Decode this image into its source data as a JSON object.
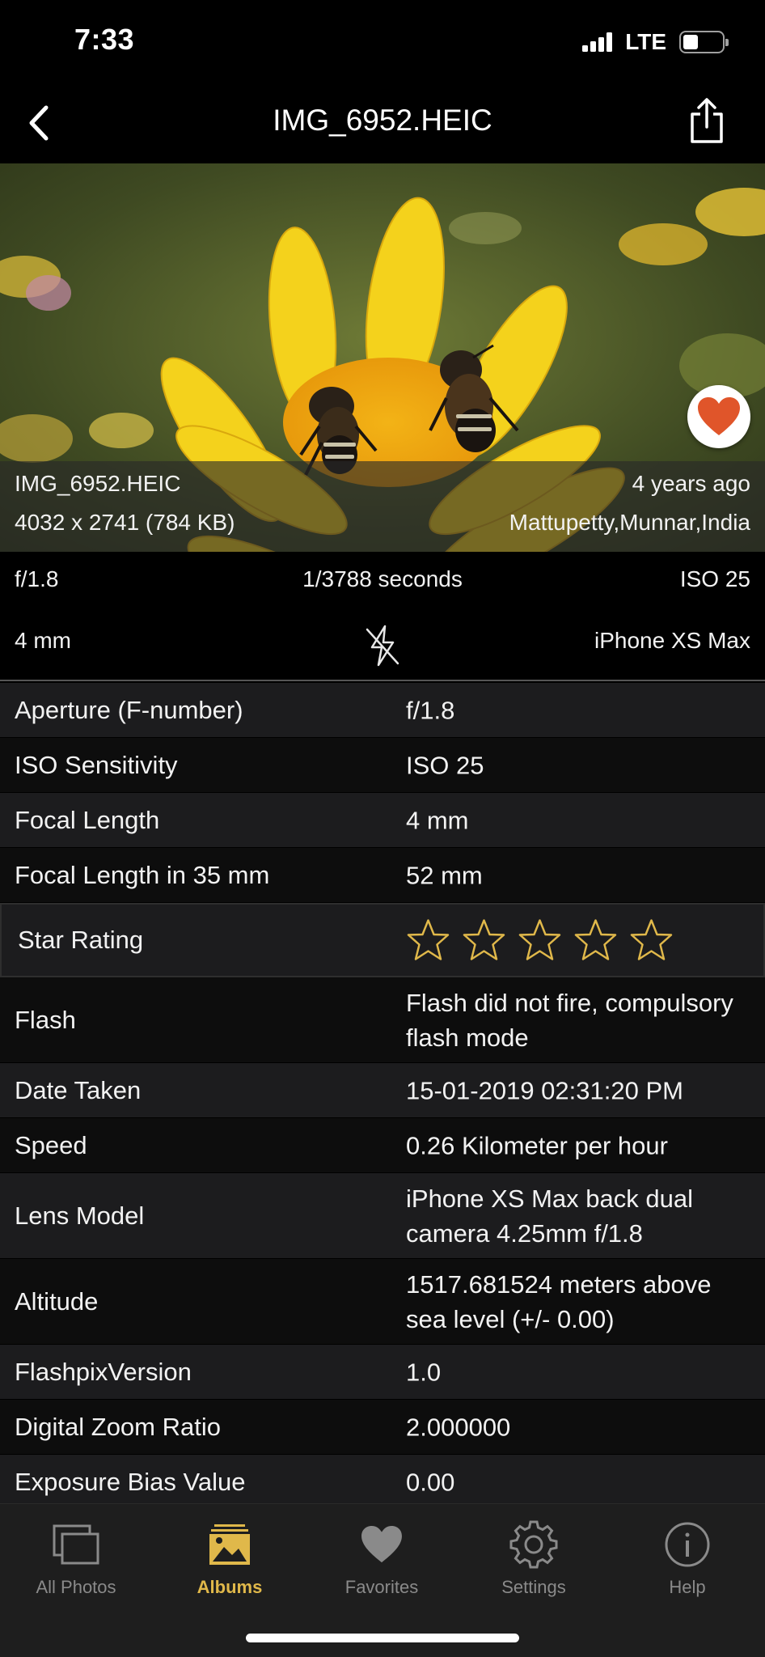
{
  "status_bar": {
    "time": "7:33",
    "network": "LTE"
  },
  "nav": {
    "title": "IMG_6952.HEIC"
  },
  "photo": {
    "filename": "IMG_6952.HEIC",
    "dimensions": "4032 x 2741 (784 KB)",
    "age": "4 years ago",
    "location": "Mattupetty,Munnar,India"
  },
  "quick_info": {
    "aperture": "f/1.8",
    "shutter": "1/3788 seconds",
    "iso": "ISO 25",
    "focal": "4 mm",
    "device": "iPhone XS Max"
  },
  "details": {
    "rows": [
      {
        "label": "Aperture (F-number)",
        "value": "f/1.8"
      },
      {
        "label": "ISO Sensitivity",
        "value": "ISO 25"
      },
      {
        "label": "Focal Length",
        "value": "4 mm"
      },
      {
        "label": "Focal Length in 35 mm",
        "value": "52 mm"
      },
      {
        "label": "Star Rating",
        "rating": 0,
        "max_rating": 5
      },
      {
        "label": "Flash",
        "value": "Flash did not fire, compulsory flash mode"
      },
      {
        "label": "Date Taken",
        "value": "15-01-2019 02:31:20 PM"
      },
      {
        "label": "Speed",
        "value": "0.26 Kilometer per hour"
      },
      {
        "label": "Lens Model",
        "value": "iPhone XS Max back dual camera 4.25mm f/1.8"
      },
      {
        "label": "Altitude",
        "value": "1517.681524 meters above sea level (+/- 0.00)"
      },
      {
        "label": "FlashpixVersion",
        "value": "1.0"
      },
      {
        "label": "Digital Zoom Ratio",
        "value": "2.000000"
      },
      {
        "label": "Exposure Bias Value",
        "value": "0.00"
      }
    ]
  },
  "tabs": [
    {
      "label": "All Photos",
      "icon": "photos-stack-icon"
    },
    {
      "label": "Albums",
      "icon": "album-icon"
    },
    {
      "label": "Favorites",
      "icon": "heart-icon"
    },
    {
      "label": "Settings",
      "icon": "gear-icon"
    },
    {
      "label": "Help",
      "icon": "info-icon"
    }
  ],
  "colors": {
    "accent": "#e0b84a",
    "tab_inactive": "#8a8a8a",
    "favorite": "#e0552a",
    "row_odd": "#1c1c1e",
    "row_even": "#0d0d0d"
  }
}
